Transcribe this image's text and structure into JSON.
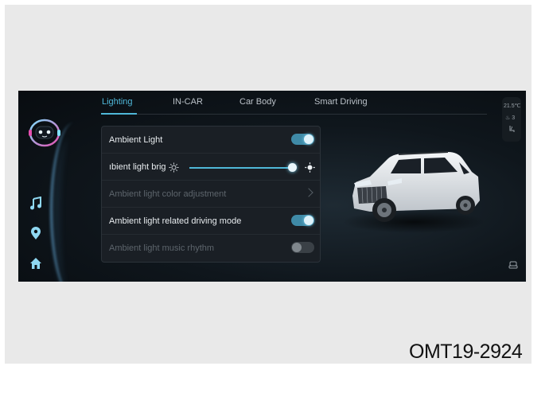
{
  "tabs": [
    {
      "label": "Lighting",
      "active": true
    },
    {
      "label": "IN-CAR",
      "active": false
    },
    {
      "label": "Car Body",
      "active": false
    },
    {
      "label": "Smart Driving",
      "active": false
    }
  ],
  "settings": {
    "ambient_light": {
      "label": "Ambient Light",
      "on": true
    },
    "brightness": {
      "label": "ıbient light brig",
      "level": 0.97
    },
    "color_adjustment": {
      "label": "Ambient light color adjustment",
      "enabled": false
    },
    "driving_mode": {
      "label": "Ambient light related driving mode",
      "on": true
    },
    "music_rhythm": {
      "label": "Ambient light music rhythm",
      "on": false,
      "enabled": false
    }
  },
  "status": {
    "temperature": "21.5℃",
    "seat_count": "3"
  },
  "sidebar": {
    "icons": [
      "assistant-avatar",
      "music-note-icon",
      "location-pin-icon",
      "home-icon"
    ]
  },
  "colors": {
    "accent": "#4fb7d8",
    "toggle_on": "#3f8aa7",
    "panel": "#1a1f25"
  },
  "figure_code": "OMT19-2924"
}
